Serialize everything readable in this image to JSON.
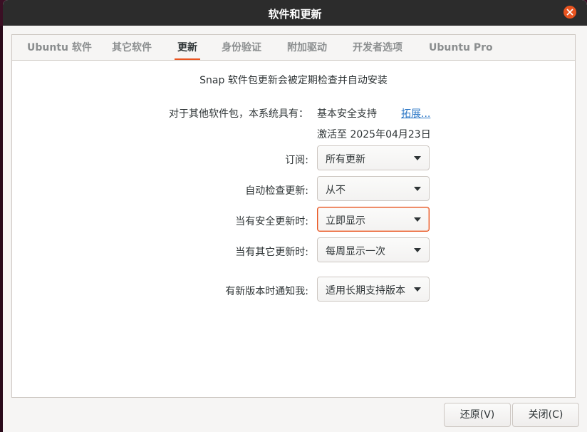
{
  "window": {
    "title": "软件和更新"
  },
  "tabs": [
    {
      "label": "Ubuntu 软件",
      "active": false
    },
    {
      "label": "其它软件",
      "active": false
    },
    {
      "label": "更新",
      "active": true
    },
    {
      "label": "身份验证",
      "active": false
    },
    {
      "label": "附加驱动",
      "active": false
    },
    {
      "label": "开发者选项",
      "active": false
    },
    {
      "label": "Ubuntu Pro",
      "active": false
    }
  ],
  "updates": {
    "snap_note": "Snap 软件包更新会被定期检查并自动安装",
    "other_packages_label": "对于其他软件包，本系统具有：",
    "support_value": "基本安全支持",
    "expand_link": "拓展...",
    "activated_text": "激活至 2025年04月23日",
    "subscribe": {
      "label": "订阅:",
      "value": "所有更新"
    },
    "auto_check": {
      "label": "自动检查更新:",
      "value": "从不"
    },
    "security_updates": {
      "label": "当有安全更新时:",
      "value": "立即显示"
    },
    "other_updates": {
      "label": "当有其它更新时:",
      "value": "每周显示一次"
    },
    "new_version": {
      "label": "有新版本时通知我:",
      "value": "适用长期支持版本"
    }
  },
  "buttons": {
    "revert": "还原(V)",
    "close": "关闭(C)"
  },
  "colors": {
    "accent": "#e95420",
    "titlebar": "#2c2c2c",
    "link": "#2a76c6"
  },
  "icons": {
    "close": "close-icon",
    "dropdown": "chevron-down-icon"
  }
}
